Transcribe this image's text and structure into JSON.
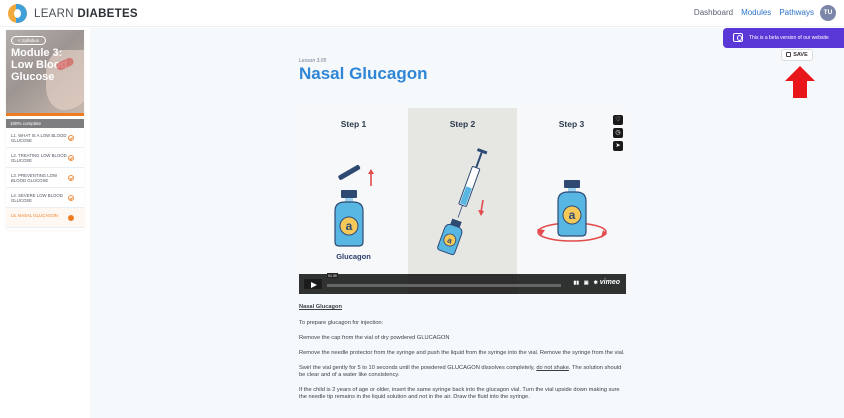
{
  "header": {
    "logo_light": "LEARN",
    "logo_bold": "DIABETES",
    "nav": [
      "Dashboard",
      "Modules",
      "Pathways"
    ],
    "active_nav": "Modules",
    "user_initials": "TU"
  },
  "sidebar": {
    "syllabus_label": "< Syllabus",
    "module_title": "Module 3: Low Blood Glucose",
    "progress_fraction": 1.0,
    "progress_label": "100% complete",
    "lessons": [
      {
        "label": "L1. WHAT IS A LOW BLOOD GLUCOSE",
        "state": "done"
      },
      {
        "label": "L2. TREATING LOW BLOOD GLUCOSE",
        "state": "done"
      },
      {
        "label": "L3. PREVENTING LOW BLOOD GLUCOSE",
        "state": "done"
      },
      {
        "label": "L4. SEVERE LOW BLOOD GLUCOSE",
        "state": "done"
      },
      {
        "label": "L5. NASAL GLUCAGON",
        "state": "current"
      }
    ]
  },
  "banner": {
    "beta_text": "This is a beta version of our website",
    "save_label": "SAVE"
  },
  "lesson": {
    "number": "Lesson 3.05",
    "title": "Nasal Glucagon"
  },
  "video": {
    "steps": [
      "Step 1",
      "Step 2",
      "Step 3"
    ],
    "glucagon_label": "Glucagon",
    "time": "01:39",
    "brand": "vimeo",
    "vial_letter": "a",
    "colors": {
      "vial": "#58b6e3",
      "cap": "#2e4a73",
      "label": "#f5c85a",
      "arrow": "#e24b4b"
    }
  },
  "article": {
    "heading": "Nasal Glucagon",
    "p1": "To prepare glucagon for injection:",
    "p2": "Remove the cap from the vial of dry powdered GLUCAGON",
    "p3": "Remove the needle protector from the syringe and push the liquid from the syringe into the vial. Remove the syringe from the vial.",
    "p4_a": "Swirl the vial gently for 5 to 10 seconds until the powdered GLUCAGON dissolves completely, ",
    "p4_b": "do not shake",
    "p4_c": ". The solution should be clear and of a water like consistency.",
    "p5": "If the child is 2 years of age or older, insert the same syringe back into the glucagon vial. Turn the vial upside down making sure the needle tip remains in the liquid solution and not in the air. Draw the fluid into the syringe."
  }
}
